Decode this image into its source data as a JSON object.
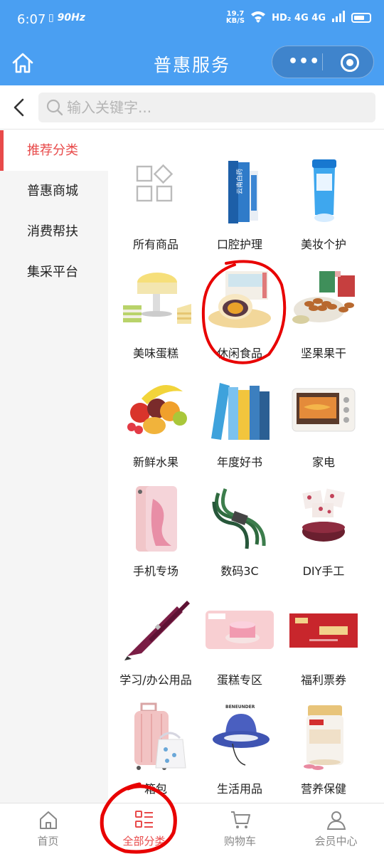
{
  "status_bar": {
    "time": "6:07",
    "hz": "90Hz",
    "speed_top": "19.7",
    "speed_bottom": "KB/S",
    "network": "HD₂ 4G 4G"
  },
  "header": {
    "title": "普惠服务"
  },
  "search": {
    "placeholder": "输入关键字..."
  },
  "sidebar": {
    "items": [
      {
        "label": "推荐分类",
        "active": true
      },
      {
        "label": "普惠商城",
        "active": false
      },
      {
        "label": "消费帮扶",
        "active": false
      },
      {
        "label": "集采平台",
        "active": false
      }
    ]
  },
  "grid": {
    "items": [
      {
        "label": "所有商品",
        "icon": "grid-icon"
      },
      {
        "label": "口腔护理",
        "icon": "toothpaste-image"
      },
      {
        "label": "美妆个护",
        "icon": "cleanser-tube-image"
      },
      {
        "label": "美味蛋糕",
        "icon": "cake-image"
      },
      {
        "label": "休闲食品",
        "icon": "pastry-image"
      },
      {
        "label": "坚果果干",
        "icon": "nuts-image"
      },
      {
        "label": "新鲜水果",
        "icon": "fruit-image"
      },
      {
        "label": "年度好书",
        "icon": "books-image"
      },
      {
        "label": "家电",
        "icon": "oven-image"
      },
      {
        "label": "手机专场",
        "icon": "phone-image"
      },
      {
        "label": "数码3C",
        "icon": "cable-image"
      },
      {
        "label": "DIY手工",
        "icon": "nougat-image"
      },
      {
        "label": "学习/办公用品",
        "icon": "pen-image"
      },
      {
        "label": "蛋糕专区",
        "icon": "cake-card-image"
      },
      {
        "label": "福利票券",
        "icon": "voucher-image"
      },
      {
        "label": "箱包",
        "icon": "luggage-image"
      },
      {
        "label": "生活用品",
        "icon": "bucket-hat-image"
      },
      {
        "label": "营养保健",
        "icon": "supplement-jar-image"
      }
    ]
  },
  "tabbar": {
    "items": [
      {
        "label": "首页",
        "icon": "home-icon",
        "active": false
      },
      {
        "label": "全部分类",
        "icon": "category-list-icon",
        "active": true
      },
      {
        "label": "购物车",
        "icon": "cart-icon",
        "active": false
      },
      {
        "label": "会员中心",
        "icon": "user-icon",
        "active": false
      }
    ]
  },
  "colors": {
    "brand_blue": "#4a9ff2",
    "accent_red": "#e84a4a",
    "annotation_red": "#e80000"
  }
}
